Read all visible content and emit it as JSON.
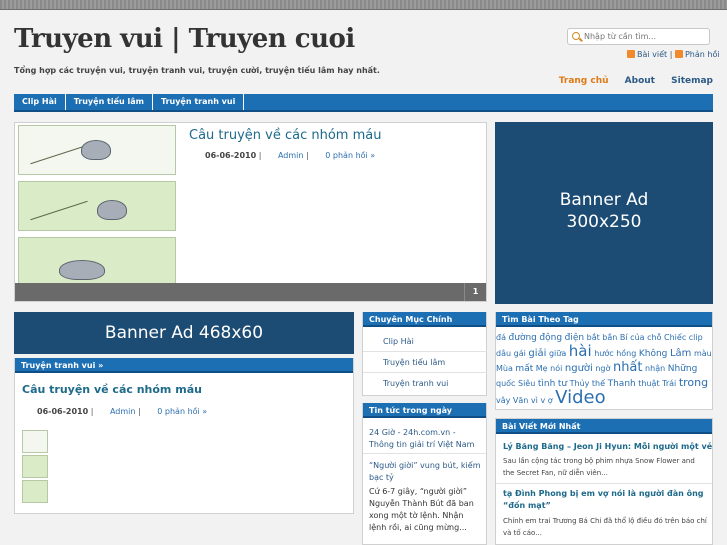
{
  "header": {
    "title": "Truyen vui | Truyen cuoi",
    "tagline": "Tổng hợp các truyện vui, truyện tranh vui, truyện cười, truyện tiếu lâm hay nhất.",
    "search_placeholder": "Nhập từ cần tìm...",
    "rss_posts": "Bài viết",
    "rss_sep": "|",
    "rss_comments": "Phản hồi"
  },
  "top_nav": [
    "Trang chủ",
    "About",
    "Sitemap"
  ],
  "cat_nav": [
    "Clip Hài",
    "Truyện tiếu lâm",
    "Truyện tranh vui"
  ],
  "featured": {
    "title": "Câu truyện về các nhóm máu",
    "date": "06-06-2010",
    "sep": "|",
    "author": "Admin",
    "sep2": "|",
    "comments": "0 phản hồi »",
    "page": "1"
  },
  "banners": {
    "right_line1": "Banner Ad",
    "right_line2": "300x250",
    "mid": "Banner Ad 468x60"
  },
  "comics_section": {
    "heading": "Truyện tranh vui »",
    "post_title": "Câu truyện về các nhóm máu",
    "date": "06-06-2010",
    "sep": "|",
    "author": "Admin",
    "sep2": "|",
    "comments": "0 phản hồi »"
  },
  "categories": {
    "heading": "Chuyên Mục Chính",
    "items": [
      "Clip Hài",
      "Truyện tiếu lâm",
      "Truyện tranh vui"
    ]
  },
  "news": {
    "heading": "Tin tức trong ngày",
    "item1": "24 Giờ - 24h.com.vn - Thông tin giải trí Việt Nam",
    "item2_title": "“Người giời” vung bút, kiếm bạc tỷ",
    "item2_text": "Cứ 6-7 giây, “người giời” Nguyễn Thành Bút đã ban xong một tờ lệnh. Nhận lệnh rồi, ai cũng mừng..."
  },
  "tags": {
    "heading": "Tìm Bài Theo Tag",
    "items": [
      {
        "t": "đá",
        "s": 8
      },
      {
        "t": "đường",
        "s": 9
      },
      {
        "t": "động",
        "s": 9
      },
      {
        "t": "điện",
        "s": 9
      },
      {
        "t": "bắt",
        "s": 8
      },
      {
        "t": "bắn",
        "s": 8
      },
      {
        "t": "Bí",
        "s": 8
      },
      {
        "t": "của",
        "s": 8
      },
      {
        "t": "chỗ",
        "s": 8
      },
      {
        "t": "Chiếc",
        "s": 8
      },
      {
        "t": "clip",
        "s": 8
      },
      {
        "t": "dâu",
        "s": 8
      },
      {
        "t": "gái",
        "s": 8
      },
      {
        "t": "giải",
        "s": 10
      },
      {
        "t": "giữa",
        "s": 8
      },
      {
        "t": "hài",
        "s": 15
      },
      {
        "t": "hước",
        "s": 8
      },
      {
        "t": "hồng",
        "s": 8
      },
      {
        "t": "Không",
        "s": 9
      },
      {
        "t": "Lâm",
        "s": 10
      },
      {
        "t": "màu",
        "s": 8
      },
      {
        "t": "Mùa",
        "s": 8
      },
      {
        "t": "mất",
        "s": 9
      },
      {
        "t": "Mẹ",
        "s": 8
      },
      {
        "t": "nói",
        "s": 8
      },
      {
        "t": "người",
        "s": 10
      },
      {
        "t": "ngờ",
        "s": 8
      },
      {
        "t": "nhất",
        "s": 13
      },
      {
        "t": "nhận",
        "s": 8
      },
      {
        "t": "Những",
        "s": 9
      },
      {
        "t": "quốc",
        "s": 8
      },
      {
        "t": "Siêu",
        "s": 8
      },
      {
        "t": "tình",
        "s": 9
      },
      {
        "t": "tư",
        "s": 9
      },
      {
        "t": "Thủy",
        "s": 8
      },
      {
        "t": "thế",
        "s": 8
      },
      {
        "t": "Thanh",
        "s": 9
      },
      {
        "t": "thuật",
        "s": 8
      },
      {
        "t": "Trái",
        "s": 8
      },
      {
        "t": "trong",
        "s": 11
      },
      {
        "t": "vây",
        "s": 8
      },
      {
        "t": "Văn",
        "s": 8
      },
      {
        "t": "vì",
        "s": 8
      },
      {
        "t": "v",
        "s": 8
      },
      {
        "t": "ợ",
        "s": 8
      },
      {
        "t": "Video",
        "s": 18
      }
    ]
  },
  "latest": {
    "heading": "Bài Viết Mới Nhất",
    "item1_title": "Lý Băng Băng – Jeon Ji Hyun: Mỗi người một vẻ",
    "item1_text": "Sau lần cộng tác trong bộ phim nhựa Snow Flower and the Secret Fan, nữ diễn viên...",
    "item2_title": "tạ Đình Phong bị em vợ nói là người đàn ông “đốn mạt”",
    "item2_text": "Chính em trai Trương Bá Chi đã thổ lộ điều đó trên báo chí và tố cáo..."
  }
}
